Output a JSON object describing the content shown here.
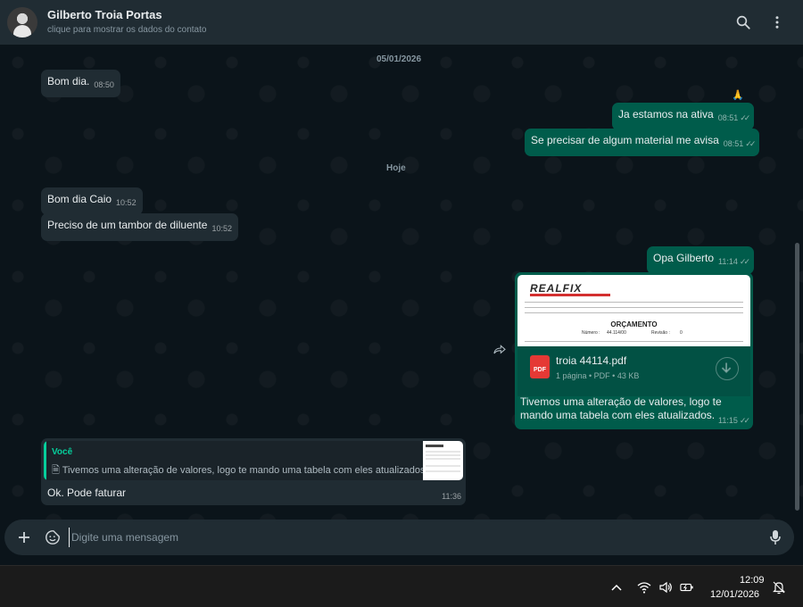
{
  "header": {
    "contact_name": "Gilberto Troia Portas",
    "contact_subtitle": "clique para mostrar os dados do contato",
    "icons": [
      "avatar",
      "search-icon",
      "menu-icon"
    ]
  },
  "chat": {
    "date_chip_1": "05/01/2026",
    "date_chip_2": "Hoje",
    "top_emoji": "🙏",
    "messages": [
      {
        "dir": "in",
        "text": "Bom dia.",
        "time": "08:50"
      },
      {
        "dir": "out",
        "text": "Ja estamos na ativa",
        "time": "08:51",
        "status": "read"
      },
      {
        "dir": "out",
        "text": "Se precisar de algum material me avisa",
        "time": "08:51",
        "status": "read"
      },
      {
        "dir": "in",
        "text": "Bom dia Caio",
        "time": "10:52"
      },
      {
        "dir": "in",
        "text": "Preciso de um tambor de diluente",
        "time": "10:52"
      },
      {
        "dir": "out",
        "text": "Opa Gilberto",
        "time": "11:14",
        "status": "read"
      }
    ],
    "ticks": "✓✓",
    "pdf_message": {
      "preview_logo": "REALFIX",
      "preview_title": "ORÇAMENTO",
      "preview_numero_label": "Número :",
      "preview_numero": "44.114/00",
      "preview_revisao_label": "Revisão :",
      "preview_revisao": "0",
      "file_icon_label": "PDF",
      "file_name": "troia 44114.pdf",
      "file_meta": "1 página • PDF • 43 KB",
      "caption": "Tivemos uma alteração de valores, logo te mando uma tabela com eles atualizados.",
      "time": "11:15",
      "status": "read"
    },
    "reply_message": {
      "quote_author": "Você",
      "quote_text": "Tivemos uma alteração de valores, logo te mando uma tabela com eles atualizados.",
      "text": "Ok. Pode faturar",
      "time": "11:36"
    }
  },
  "composer": {
    "placeholder": "Digite uma mensagem"
  },
  "taskbar": {
    "time": "12:09",
    "date": "12/01/2026"
  },
  "colors": {
    "header_bg": "#202c33",
    "chat_bg": "#0b141a",
    "incoming_bubble": "#202c33",
    "outgoing_bubble": "#005c4b",
    "accent": "#06cf9c"
  }
}
